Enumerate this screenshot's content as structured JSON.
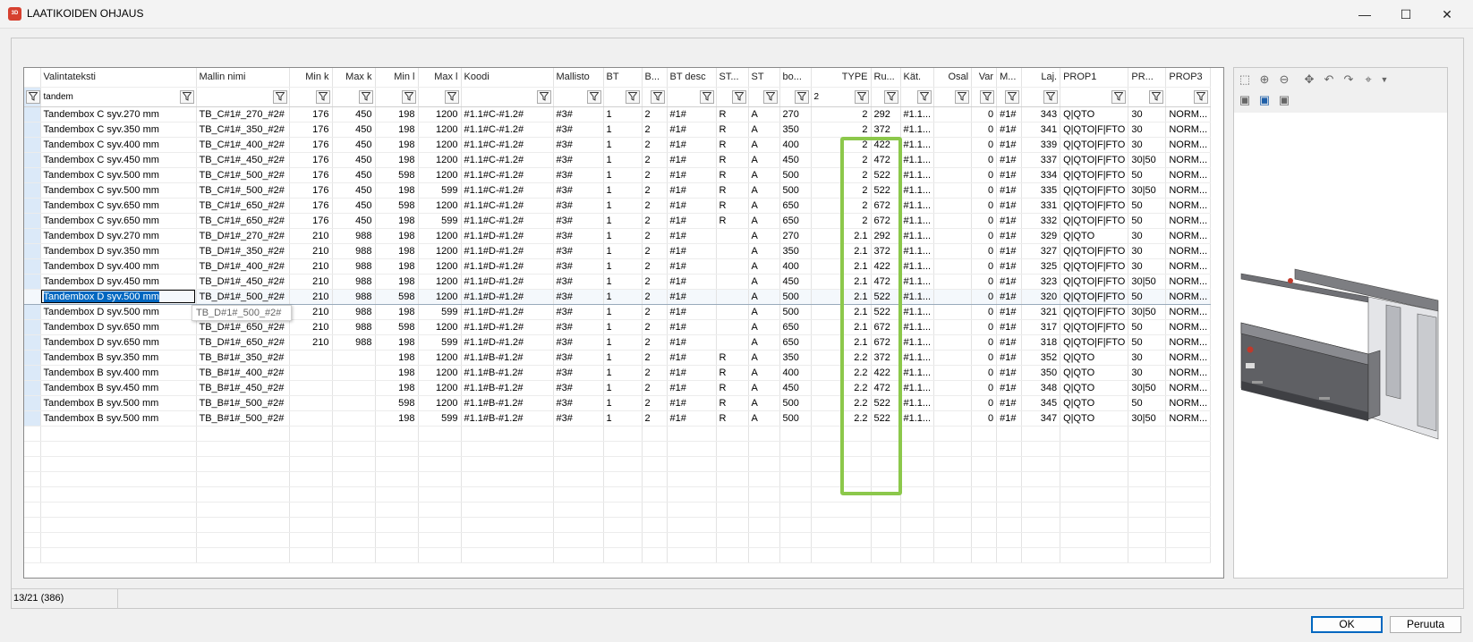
{
  "window": {
    "title": "LAATIKOIDEN OHJAUS",
    "app_icon": "3D",
    "minimize": "—",
    "maximize": "☐",
    "close": "✕"
  },
  "columns": [
    {
      "key": "valintateksti",
      "label": "Valintateksti",
      "width": 174,
      "align": "left"
    },
    {
      "key": "mallin_nimi",
      "label": "Mallin nimi",
      "width": 104,
      "align": "left"
    },
    {
      "key": "min_k",
      "label": "Min k",
      "width": 48,
      "align": "right"
    },
    {
      "key": "max_k",
      "label": "Max k",
      "width": 48,
      "align": "right"
    },
    {
      "key": "min_l",
      "label": "Min l",
      "width": 48,
      "align": "right"
    },
    {
      "key": "max_l",
      "label": "Max l",
      "width": 48,
      "align": "right"
    },
    {
      "key": "koodi",
      "label": "Koodi",
      "width": 103,
      "align": "left"
    },
    {
      "key": "mallisto",
      "label": "Mallisto",
      "width": 56,
      "align": "left"
    },
    {
      "key": "bt",
      "label": "BT",
      "width": 43,
      "align": "left"
    },
    {
      "key": "b",
      "label": "B...",
      "width": 28,
      "align": "left"
    },
    {
      "key": "bt_desc",
      "label": "BT desc",
      "width": 55,
      "align": "left"
    },
    {
      "key": "st1",
      "label": "ST...",
      "width": 36,
      "align": "left"
    },
    {
      "key": "st",
      "label": "ST",
      "width": 35,
      "align": "left"
    },
    {
      "key": "bo",
      "label": "bo...",
      "width": 35,
      "align": "left"
    },
    {
      "key": "type",
      "label": "TYPE",
      "width": 67,
      "align": "right"
    },
    {
      "key": "ru",
      "label": "Ru...",
      "width": 33,
      "align": "left"
    },
    {
      "key": "kat",
      "label": "Kät.",
      "width": 34,
      "align": "left"
    },
    {
      "key": "osal",
      "label": "Osal",
      "width": 42,
      "align": "right"
    },
    {
      "key": "var",
      "label": "Var",
      "width": 28,
      "align": "right"
    },
    {
      "key": "m",
      "label": "M...",
      "width": 28,
      "align": "left"
    },
    {
      "key": "laj",
      "label": "Laj.",
      "width": 43,
      "align": "right"
    },
    {
      "key": "prop1",
      "label": "PROP1",
      "width": 70,
      "align": "left"
    },
    {
      "key": "pr",
      "label": "PR...",
      "width": 42,
      "align": "left"
    },
    {
      "key": "prop3",
      "label": "PROP3",
      "width": 50,
      "align": "left"
    }
  ],
  "filters": {
    "valintateksti": "tandem",
    "type": "2"
  },
  "rows": [
    [
      "Tandembox C syv.270 mm",
      "TB_C#1#_270_#2#",
      "176",
      "450",
      "198",
      "1200",
      "#1.1#C-#1.2#",
      "#3#",
      "1",
      "2",
      "#1#",
      "R",
      "A",
      "270",
      "2",
      "292",
      "#1.1...",
      "",
      "0",
      "#1#",
      "343",
      "Q|QTO",
      "30",
      "NORM..."
    ],
    [
      "Tandembox C syv.350 mm",
      "TB_C#1#_350_#2#",
      "176",
      "450",
      "198",
      "1200",
      "#1.1#C-#1.2#",
      "#3#",
      "1",
      "2",
      "#1#",
      "R",
      "A",
      "350",
      "2",
      "372",
      "#1.1...",
      "",
      "0",
      "#1#",
      "341",
      "Q|QTO|F|FTO",
      "30",
      "NORM..."
    ],
    [
      "Tandembox C syv.400 mm",
      "TB_C#1#_400_#2#",
      "176",
      "450",
      "198",
      "1200",
      "#1.1#C-#1.2#",
      "#3#",
      "1",
      "2",
      "#1#",
      "R",
      "A",
      "400",
      "2",
      "422",
      "#1.1...",
      "",
      "0",
      "#1#",
      "339",
      "Q|QTO|F|FTO",
      "30",
      "NORM..."
    ],
    [
      "Tandembox C syv.450 mm",
      "TB_C#1#_450_#2#",
      "176",
      "450",
      "198",
      "1200",
      "#1.1#C-#1.2#",
      "#3#",
      "1",
      "2",
      "#1#",
      "R",
      "A",
      "450",
      "2",
      "472",
      "#1.1...",
      "",
      "0",
      "#1#",
      "337",
      "Q|QTO|F|FTO",
      "30|50",
      "NORM..."
    ],
    [
      "Tandembox C syv.500 mm",
      "TB_C#1#_500_#2#",
      "176",
      "450",
      "598",
      "1200",
      "#1.1#C-#1.2#",
      "#3#",
      "1",
      "2",
      "#1#",
      "R",
      "A",
      "500",
      "2",
      "522",
      "#1.1...",
      "",
      "0",
      "#1#",
      "334",
      "Q|QTO|F|FTO",
      "50",
      "NORM..."
    ],
    [
      "Tandembox C syv.500 mm",
      "TB_C#1#_500_#2#",
      "176",
      "450",
      "198",
      "599",
      "#1.1#C-#1.2#",
      "#3#",
      "1",
      "2",
      "#1#",
      "R",
      "A",
      "500",
      "2",
      "522",
      "#1.1...",
      "",
      "0",
      "#1#",
      "335",
      "Q|QTO|F|FTO",
      "30|50",
      "NORM..."
    ],
    [
      "Tandembox C syv.650 mm",
      "TB_C#1#_650_#2#",
      "176",
      "450",
      "598",
      "1200",
      "#1.1#C-#1.2#",
      "#3#",
      "1",
      "2",
      "#1#",
      "R",
      "A",
      "650",
      "2",
      "672",
      "#1.1...",
      "",
      "0",
      "#1#",
      "331",
      "Q|QTO|F|FTO",
      "50",
      "NORM..."
    ],
    [
      "Tandembox C syv.650 mm",
      "TB_C#1#_650_#2#",
      "176",
      "450",
      "198",
      "599",
      "#1.1#C-#1.2#",
      "#3#",
      "1",
      "2",
      "#1#",
      "R",
      "A",
      "650",
      "2",
      "672",
      "#1.1...",
      "",
      "0",
      "#1#",
      "332",
      "Q|QTO|F|FTO",
      "50",
      "NORM..."
    ],
    [
      "Tandembox D syv.270 mm",
      "TB_D#1#_270_#2#",
      "210",
      "988",
      "198",
      "1200",
      "#1.1#D-#1.2#",
      "#3#",
      "1",
      "2",
      "#1#",
      "",
      "A",
      "270",
      "2.1",
      "292",
      "#1.1...",
      "",
      "0",
      "#1#",
      "329",
      "Q|QTO",
      "30",
      "NORM..."
    ],
    [
      "Tandembox D syv.350 mm",
      "TB_D#1#_350_#2#",
      "210",
      "988",
      "198",
      "1200",
      "#1.1#D-#1.2#",
      "#3#",
      "1",
      "2",
      "#1#",
      "",
      "A",
      "350",
      "2.1",
      "372",
      "#1.1...",
      "",
      "0",
      "#1#",
      "327",
      "Q|QTO|F|FTO",
      "30",
      "NORM..."
    ],
    [
      "Tandembox D syv.400 mm",
      "TB_D#1#_400_#2#",
      "210",
      "988",
      "198",
      "1200",
      "#1.1#D-#1.2#",
      "#3#",
      "1",
      "2",
      "#1#",
      "",
      "A",
      "400",
      "2.1",
      "422",
      "#1.1...",
      "",
      "0",
      "#1#",
      "325",
      "Q|QTO|F|FTO",
      "30",
      "NORM..."
    ],
    [
      "Tandembox D syv.450 mm",
      "TB_D#1#_450_#2#",
      "210",
      "988",
      "198",
      "1200",
      "#1.1#D-#1.2#",
      "#3#",
      "1",
      "2",
      "#1#",
      "",
      "A",
      "450",
      "2.1",
      "472",
      "#1.1...",
      "",
      "0",
      "#1#",
      "323",
      "Q|QTO|F|FTO",
      "30|50",
      "NORM..."
    ],
    [
      "Tandembox D syv.500 mm",
      "TB_D#1#_500_#2#",
      "210",
      "988",
      "598",
      "1200",
      "#1.1#D-#1.2#",
      "#3#",
      "1",
      "2",
      "#1#",
      "",
      "A",
      "500",
      "2.1",
      "522",
      "#1.1...",
      "",
      "0",
      "#1#",
      "320",
      "Q|QTO|F|FTO",
      "50",
      "NORM..."
    ],
    [
      "Tandembox D syv.500 mm",
      "TB_D#1#_500_#2#",
      "210",
      "988",
      "198",
      "599",
      "#1.1#D-#1.2#",
      "#3#",
      "1",
      "2",
      "#1#",
      "",
      "A",
      "500",
      "2.1",
      "522",
      "#1.1...",
      "",
      "0",
      "#1#",
      "321",
      "Q|QTO|F|FTO",
      "30|50",
      "NORM..."
    ],
    [
      "Tandembox D syv.650 mm",
      "TB_D#1#_650_#2#",
      "210",
      "988",
      "598",
      "1200",
      "#1.1#D-#1.2#",
      "#3#",
      "1",
      "2",
      "#1#",
      "",
      "A",
      "650",
      "2.1",
      "672",
      "#1.1...",
      "",
      "0",
      "#1#",
      "317",
      "Q|QTO|F|FTO",
      "50",
      "NORM..."
    ],
    [
      "Tandembox D syv.650 mm",
      "TB_D#1#_650_#2#",
      "210",
      "988",
      "198",
      "599",
      "#1.1#D-#1.2#",
      "#3#",
      "1",
      "2",
      "#1#",
      "",
      "A",
      "650",
      "2.1",
      "672",
      "#1.1...",
      "",
      "0",
      "#1#",
      "318",
      "Q|QTO|F|FTO",
      "50",
      "NORM..."
    ],
    [
      "Tandembox B syv.350 mm",
      "TB_B#1#_350_#2#",
      "",
      "",
      "198",
      "1200",
      "#1.1#B-#1.2#",
      "#3#",
      "1",
      "2",
      "#1#",
      "R",
      "A",
      "350",
      "2.2",
      "372",
      "#1.1...",
      "",
      "0",
      "#1#",
      "352",
      "Q|QTO",
      "30",
      "NORM..."
    ],
    [
      "Tandembox B syv.400 mm",
      "TB_B#1#_400_#2#",
      "",
      "",
      "198",
      "1200",
      "#1.1#B-#1.2#",
      "#3#",
      "1",
      "2",
      "#1#",
      "R",
      "A",
      "400",
      "2.2",
      "422",
      "#1.1...",
      "",
      "0",
      "#1#",
      "350",
      "Q|QTO",
      "30",
      "NORM..."
    ],
    [
      "Tandembox B syv.450 mm",
      "TB_B#1#_450_#2#",
      "",
      "",
      "198",
      "1200",
      "#1.1#B-#1.2#",
      "#3#",
      "1",
      "2",
      "#1#",
      "R",
      "A",
      "450",
      "2.2",
      "472",
      "#1.1...",
      "",
      "0",
      "#1#",
      "348",
      "Q|QTO",
      "30|50",
      "NORM..."
    ],
    [
      "Tandembox B syv.500 mm",
      "TB_B#1#_500_#2#",
      "",
      "",
      "598",
      "1200",
      "#1.1#B-#1.2#",
      "#3#",
      "1",
      "2",
      "#1#",
      "R",
      "A",
      "500",
      "2.2",
      "522",
      "#1.1...",
      "",
      "0",
      "#1#",
      "345",
      "Q|QTO",
      "50",
      "NORM..."
    ],
    [
      "Tandembox B syv.500 mm",
      "TB_B#1#_500_#2#",
      "",
      "",
      "198",
      "599",
      "#1.1#B-#1.2#",
      "#3#",
      "1",
      "2",
      "#1#",
      "R",
      "A",
      "500",
      "2.2",
      "522",
      "#1.1...",
      "",
      "0",
      "#1#",
      "347",
      "Q|QTO",
      "30|50",
      "NORM..."
    ]
  ],
  "current_row_index": 12,
  "tooltip": "TB_D#1#_500_#2#",
  "status": "13/21 (386)",
  "buttons": {
    "ok": "OK",
    "cancel": "Peruuta"
  },
  "colors": {
    "highlight": "#8cc84b",
    "selection": "#0067c0",
    "row_selector": "#dbe9f8"
  }
}
